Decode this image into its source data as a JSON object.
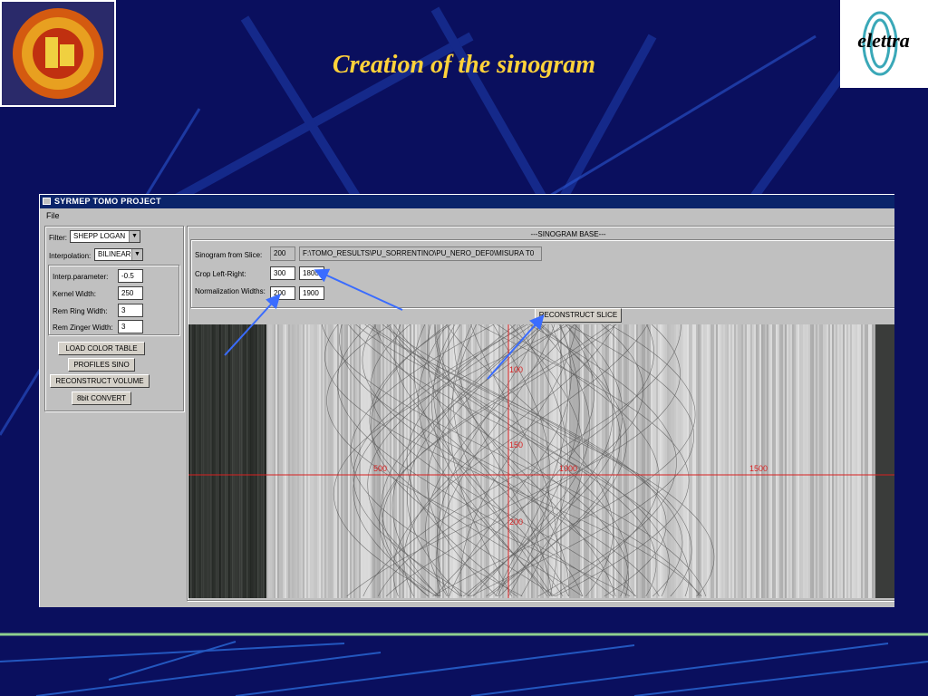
{
  "slide": {
    "title": "Creation of the sinogram",
    "logo_right_text": "elettra"
  },
  "window": {
    "title": "SYRMEP TOMO PROJECT",
    "menu": [
      "File"
    ]
  },
  "left_panel": {
    "filter_label": "Filter:",
    "filter_value": "SHEPP LOGAN",
    "interp_label": "Interpolation:",
    "interp_value": "BILINEAR",
    "params": [
      {
        "label": "Interp.parameter:",
        "value": "-0.5"
      },
      {
        "label": "Kernel Width:",
        "value": "250"
      },
      {
        "label": "Rem Ring Width:",
        "value": "3"
      },
      {
        "label": "Rem Zinger Width:",
        "value": "3"
      }
    ],
    "buttons": [
      "LOAD COLOR TABLE",
      "PROFILES SINO",
      "RECONSTRUCT VOLUME",
      "8bit CONVERT"
    ]
  },
  "sinogram_panel": {
    "header": "---SINOGRAM BASE---",
    "slice_label": "Sinogram from Slice:",
    "slice_value": "200",
    "path_value": "F:\\TOMO_RESULTS\\PU_SORRENTINO\\PU_NERO_DEF0\\MISURA T0",
    "crop_label": "Crop Left-Right:",
    "crop_left": "300",
    "crop_right": "1800",
    "norm_label": "Normalization Widths:",
    "norm_left": "200",
    "norm_right": "1900",
    "reconstruct_button": "RECONSTRUCT SLICE"
  },
  "sinogram_axes": {
    "x_ticks": [
      "500",
      "1000",
      "1500"
    ],
    "y_ticks": [
      "100",
      "150",
      "200"
    ]
  },
  "colors": {
    "background": "#0a0f5e",
    "title": "#ffd23a",
    "titlebar": "#0a246a",
    "axis": "#d82020",
    "arrow": "#3a6cff"
  }
}
